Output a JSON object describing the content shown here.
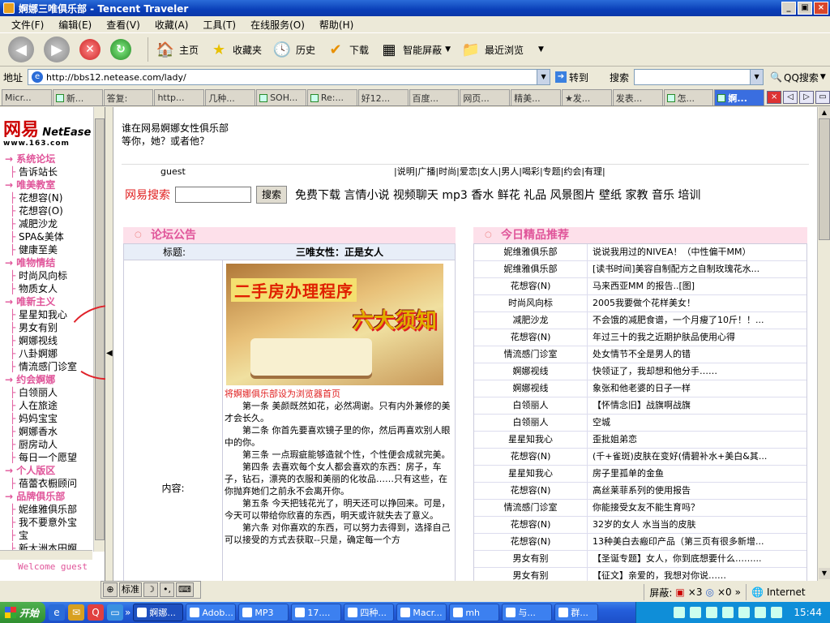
{
  "window": {
    "title": "婀娜三唯俱乐部 - Tencent Traveler"
  },
  "menu": [
    "文件(F)",
    "编辑(E)",
    "查看(V)",
    "收藏(A)",
    "工具(T)",
    "在线服务(O)",
    "帮助(H)"
  ],
  "toolbar": {
    "home": "主页",
    "favorites": "收藏夹",
    "history": "历史",
    "download": "下载",
    "smart_screen": "智能屏蔽",
    "recent": "最近浏览"
  },
  "address": {
    "label": "地址",
    "url": "http://bbs12.netease.com/lady/",
    "go": "转到",
    "search_label": "搜索",
    "qq_search": "QQ搜索"
  },
  "tabs": [
    "Micr...",
    "新...",
    "答复:",
    "http...",
    "几种...",
    "SOH...",
    "Re:...",
    "好12...",
    "百度...",
    "网页...",
    "精美...",
    "★发...",
    "发表...",
    "怎...",
    "婀..."
  ],
  "sidebar": {
    "logo_cn": "网易",
    "logo_en": "NetEase",
    "logo_url": "www.163.com",
    "items": [
      {
        "t": "系统论坛",
        "cat": true
      },
      {
        "t": "告诉站长"
      },
      {
        "t": "唯美教室",
        "cat": true
      },
      {
        "t": "花想容(N)"
      },
      {
        "t": "花想容(O)"
      },
      {
        "t": "减肥沙龙"
      },
      {
        "t": "SPA&美体"
      },
      {
        "t": "健康至美"
      },
      {
        "t": "唯物情结",
        "cat": true
      },
      {
        "t": "时尚风向标"
      },
      {
        "t": "物质女人"
      },
      {
        "t": "唯新主义",
        "cat": true
      },
      {
        "t": "星星知我心"
      },
      {
        "t": "男女有别"
      },
      {
        "t": "婀娜视线"
      },
      {
        "t": "八卦婀娜"
      },
      {
        "t": "情流感门诊室"
      },
      {
        "t": "约会婀娜",
        "cat": true
      },
      {
        "t": "白领丽人"
      },
      {
        "t": "人在旅途"
      },
      {
        "t": "妈妈宝宝"
      },
      {
        "t": "婀娜香水"
      },
      {
        "t": "厨房动人"
      },
      {
        "t": "每日一个愿望"
      },
      {
        "t": "个人版区",
        "cat": true
      },
      {
        "t": "蓓蕾衣橱顾问"
      },
      {
        "t": "品牌俱乐部",
        "cat": true
      },
      {
        "t": "妮维雅俱乐部"
      },
      {
        "t": "我不要意外宝"
      },
      {
        "t": "宝"
      },
      {
        "t": "新大洲本田婀"
      }
    ],
    "welcome": "Welcome guest"
  },
  "main": {
    "intro1": "谁在网易婀娜女性俱乐部",
    "intro2": "等你，她？或者他？",
    "guest": "guest",
    "nav_links": "|说明|广播|时尚|爱恋|女人|男人|喝彩|专题|约会|有理|",
    "search_label": "网易搜索",
    "search_btn": "搜索",
    "quick_links": "免费下载 言情小说 视频聊天 mp3 香水 鲜花 礼品 风景图片 壁纸 家教 音乐 培训",
    "announce": {
      "header": "论坛公告",
      "title_key": "标题:",
      "title_val": "三唯女性：正是女人",
      "content_key": "内容:",
      "ad_line1": "二手房办理程序",
      "ad_line2": "六大须知",
      "set_home": "将婀娜俱乐部设为浏览器首页",
      "paras": [
        "第一条 美颜既然如花，必然凋谢。只有内外兼修的美才会长久。",
        "第二条 你首先要喜欢镜子里的你，然后再喜欢别人眼中的你。",
        "第三条 一点瑕疵能够造就个性，个性便会成就完美。",
        "第四条 去喜欢每个女人都会喜欢的东西：房子，车子，钻石，漂亮的衣服和美丽的化妆品……只有这些，在你抛弃她们之前永不会离开你。",
        "第五条 今天把钱花光了，明天还可以挣回来。可是，今天可以带给你欣喜的东西，明天或许就失去了意义。",
        "第六条 对你喜欢的东西，可以努力去得到，选择自己可以接受的方式去获取--只是，确定每一个方"
      ]
    },
    "picks": {
      "header": "今日精品推荐",
      "rows": [
        [
          "妮维雅俱乐部",
          "说说我用过的NIVEA！（中性偏干MM）"
        ],
        [
          "妮维雅俱乐部",
          "[读书时间]美容自制配方之自制玫瑰花水..."
        ],
        [
          "花想容(N)",
          "马来西亚MM 的报告..[图]"
        ],
        [
          "时尚风向标",
          "2005我要做个花样美女！"
        ],
        [
          "减肥沙龙",
          "不会饿的减肥食谱，一个月瘦了10斤！！..."
        ],
        [
          "花想容(N)",
          "年过三十的我之近期护肤品使用心得"
        ],
        [
          "情流感门诊室",
          "处女情节不全是男人的错"
        ],
        [
          "婀娜视线",
          "快领证了，我却想和他分手……"
        ],
        [
          "婀娜视线",
          "象张和他老婆的日子一样"
        ],
        [
          "白领丽人",
          "【怀情念旧】战旗啊战旗"
        ],
        [
          "白领丽人",
          "空城"
        ],
        [
          "星星知我心",
          "歪批姐弟恋"
        ],
        [
          "花想容(N)",
          "(千+雀斑)皮肤在变好(倩碧补水+美白&其..."
        ],
        [
          "星星知我心",
          "房子里孤单的金鱼"
        ],
        [
          "花想容(N)",
          "高丝莱菲系列的使用报告"
        ],
        [
          "情流感门诊室",
          "你能接受女友不能生育吗？"
        ],
        [
          "花想容(N)",
          "32岁的女人 水当当的皮肤"
        ],
        [
          "花想容(N)",
          "13种美白去瘢印产品（第三页有很多新增..."
        ],
        [
          "男女有别",
          "【圣诞专题】女人，你到底想要什么……..."
        ],
        [
          "男女有别",
          "【征文】亲爱的，我想对你说……"
        ]
      ]
    }
  },
  "langbar": {
    "ime": "标准",
    "moon": "☽",
    "dot": "•,",
    "kbd": "⌨"
  },
  "status": {
    "screen": "屏蔽:",
    "x3": "×3",
    "x0": "×0",
    "zone": "Internet"
  },
  "taskbar": {
    "start": "开始",
    "tasks": [
      "婀娜...",
      "Adob...",
      "MP3",
      "17....",
      "四种...",
      "Macr...",
      "mh",
      "与...",
      "群..."
    ],
    "clock": "15:44"
  },
  "colors": {
    "pink": "#e0559a",
    "red": "#e02020",
    "title_blue": "#0a3fb8"
  }
}
